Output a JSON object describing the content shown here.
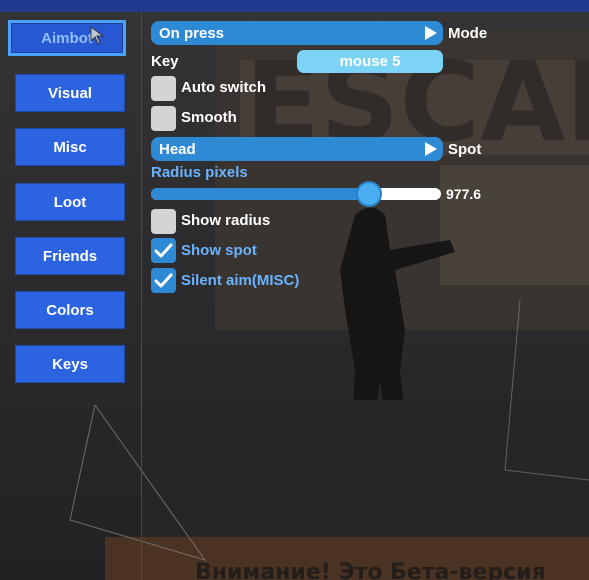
{
  "colors": {
    "accent": "#2f8ad6",
    "nav": "#2b63e0",
    "active_border": "#4aa3ff",
    "check_label": "#6ab3ff"
  },
  "sidebar": {
    "items": [
      {
        "label": "Aimbot",
        "active": true
      },
      {
        "label": "Visual",
        "active": false
      },
      {
        "label": "Misc",
        "active": false
      },
      {
        "label": "Loot",
        "active": false
      },
      {
        "label": "Friends",
        "active": false
      },
      {
        "label": "Colors",
        "active": false
      },
      {
        "label": "Keys",
        "active": false
      }
    ]
  },
  "aimbot": {
    "mode_value": "On press",
    "mode_label": "Mode",
    "key_label": "Key",
    "key_value": "mouse 5",
    "auto_switch": {
      "label": "Auto switch",
      "checked": false
    },
    "smooth": {
      "label": "Smooth",
      "checked": false
    },
    "spot_value": "Head",
    "spot_label": "Spot",
    "radius_label": "Radius pixels",
    "radius_value": "977.6",
    "radius_fraction": 0.75,
    "show_radius": {
      "label": "Show radius",
      "checked": false
    },
    "show_spot": {
      "label": "Show spot",
      "checked": true
    },
    "silent_aim": {
      "label": "Silent aim(MISC)",
      "checked": true
    }
  },
  "background": {
    "banner_text": "Внимание! Это Бета-версия"
  }
}
